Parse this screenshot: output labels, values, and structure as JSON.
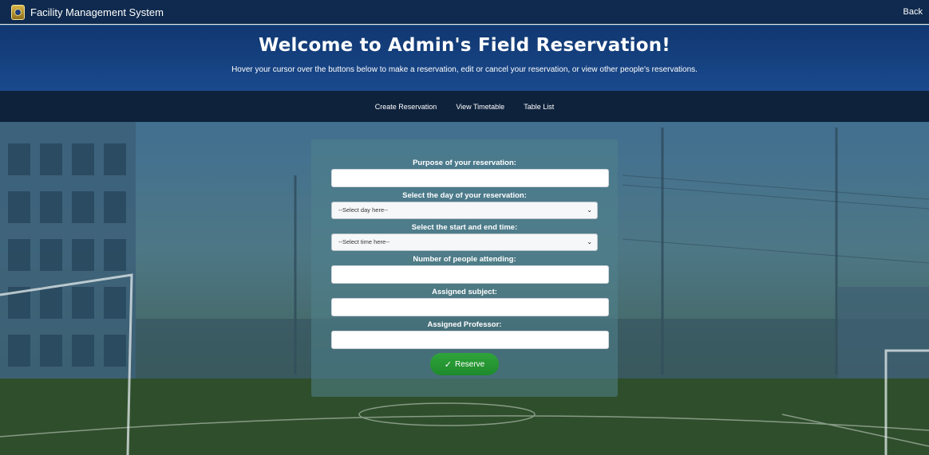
{
  "topbar": {
    "app_title": "Facility Management System",
    "back_label": "Back"
  },
  "hero": {
    "title": "Welcome to Admin's Field Reservation!",
    "subtitle": "Hover your cursor over the buttons below to make a reservation, edit or cancel your reservation, or view other people's reservations."
  },
  "nav": {
    "items": [
      {
        "label": "Create Reservation"
      },
      {
        "label": "View Timetable"
      },
      {
        "label": "Table List"
      }
    ]
  },
  "form": {
    "purpose_label": "Purpose of your reservation:",
    "purpose_value": "",
    "day_label": "Select the day of your reservation:",
    "day_value": "--Select day here--",
    "time_label": "Select the start and end time:",
    "time_value": "--Select time here--",
    "people_label": "Number of people attending:",
    "people_value": "",
    "subject_label": "Assigned subject:",
    "subject_value": "",
    "professor_label": "Assigned Professor:",
    "professor_value": "",
    "submit_label": "Reserve",
    "submit_icon": "check-icon"
  },
  "colors": {
    "topbar": "#0f2a4e",
    "hero": "#16468c",
    "navbar": "#0e223c",
    "submit": "#1e8a2c"
  }
}
